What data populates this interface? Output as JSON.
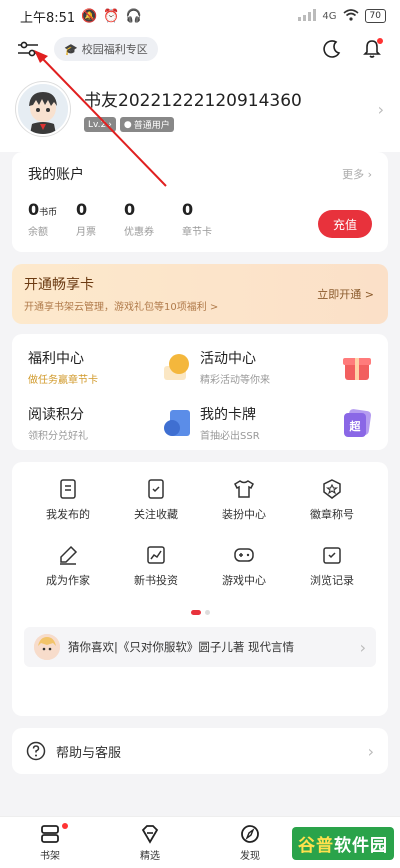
{
  "statusbar": {
    "time": "上午8:51",
    "network": "4G",
    "battery": "70"
  },
  "topbar": {
    "campus_chip": "校园福利专区"
  },
  "profile": {
    "username": "书友20221222120914360",
    "level": "Lv.2",
    "role": "普通用户"
  },
  "account": {
    "title": "我的账户",
    "more": "更多",
    "items": [
      {
        "value": "0",
        "unit": "书币",
        "label": "余额"
      },
      {
        "value": "0",
        "unit": "",
        "label": "月票"
      },
      {
        "value": "0",
        "unit": "",
        "label": "优惠券"
      },
      {
        "value": "0",
        "unit": "",
        "label": "章节卡"
      }
    ],
    "recharge": "充值"
  },
  "vip": {
    "title": "开通畅享卡",
    "subtitle": "开通享书架云管理，游戏礼包等10项福利 >",
    "button": "立即开通 >"
  },
  "welfare": [
    {
      "title": "福利中心",
      "subtitle": "做任务赢章节卡",
      "icon": "coin-icon"
    },
    {
      "title": "活动中心",
      "subtitle": "精彩活动等你来",
      "icon": "gift-icon"
    },
    {
      "title": "阅读积分",
      "subtitle": "领积分兑好礼",
      "icon": "book-points-icon"
    },
    {
      "title": "我的卡牌",
      "subtitle": "首抽必出SSR",
      "icon": "card-icon"
    }
  ],
  "tools": [
    {
      "label": "我发布的",
      "icon": "document-icon"
    },
    {
      "label": "关注收藏",
      "icon": "bookmark-check-icon"
    },
    {
      "label": "装扮中心",
      "icon": "shirt-icon"
    },
    {
      "label": "徽章称号",
      "icon": "badge-icon"
    },
    {
      "label": "成为作家",
      "icon": "pen-icon"
    },
    {
      "label": "新书投资",
      "icon": "chart-icon"
    },
    {
      "label": "游戏中心",
      "icon": "gamepad-icon"
    },
    {
      "label": "浏览记录",
      "icon": "history-icon"
    }
  ],
  "recommend": {
    "text": "猜你喜欢|《只对你服软》圆子儿著 现代言情"
  },
  "help": {
    "label": "帮助与客服"
  },
  "nav": [
    {
      "label": "书架"
    },
    {
      "label": "精选"
    },
    {
      "label": "发现"
    }
  ],
  "watermark": {
    "part1": "谷普",
    "part2": "软件园"
  },
  "colors": {
    "accent": "#e8323c",
    "vip_bg": "#fde9cc"
  }
}
